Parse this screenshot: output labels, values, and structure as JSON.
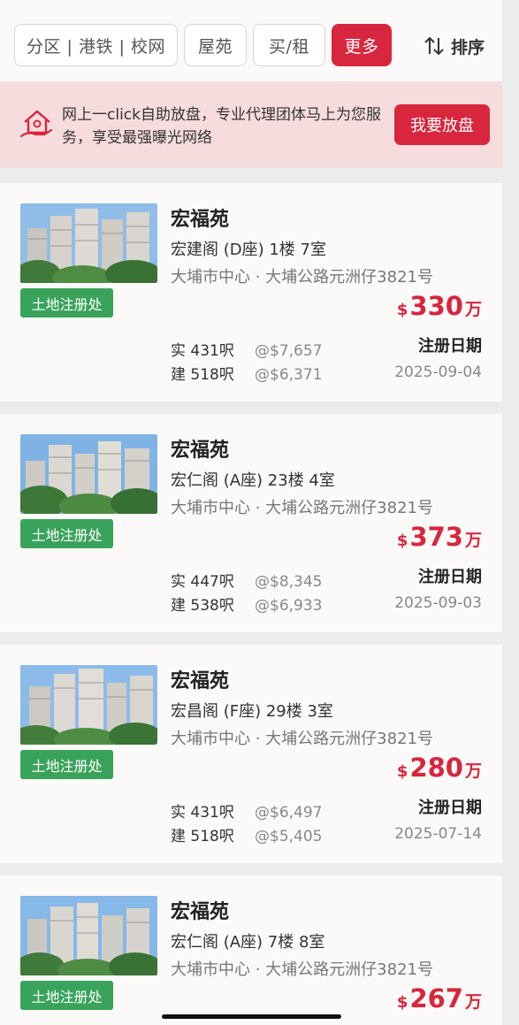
{
  "filters": {
    "district": "分区 | 港铁 | 校网",
    "estate": "屋苑",
    "buy_rent": "买/租",
    "more": "更多",
    "sort": "排序"
  },
  "banner": {
    "text": "网上一click自助放盘，专业代理团体马上为您服务，享受最强曝光网络",
    "cta": "我要放盘"
  },
  "listings": [
    {
      "estate": "宏福苑",
      "unit": "宏建阁 (D座) 1楼 7室",
      "address": "大埔市中心 · 大埔公路元洲仔3821号",
      "tag": "土地注册处",
      "currency": "$",
      "price": "330",
      "price_unit": "万",
      "saleable": "实 431呎",
      "saleable_ppsf": "@$7,657",
      "gross": "建 518呎",
      "gross_ppsf": "@$6,371",
      "reg_label": "注册日期",
      "reg_date": "2025-09-04"
    },
    {
      "estate": "宏福苑",
      "unit": "宏仁阁 (A座) 23楼 4室",
      "address": "大埔市中心 · 大埔公路元洲仔3821号",
      "tag": "土地注册处",
      "currency": "$",
      "price": "373",
      "price_unit": "万",
      "saleable": "实 447呎",
      "saleable_ppsf": "@$8,345",
      "gross": "建 538呎",
      "gross_ppsf": "@$6,933",
      "reg_label": "注册日期",
      "reg_date": "2025-09-03"
    },
    {
      "estate": "宏福苑",
      "unit": "宏昌阁 (F座) 29楼 3室",
      "address": "大埔市中心 · 大埔公路元洲仔3821号",
      "tag": "土地注册处",
      "currency": "$",
      "price": "280",
      "price_unit": "万",
      "saleable": "实 431呎",
      "saleable_ppsf": "@$6,497",
      "gross": "建 518呎",
      "gross_ppsf": "@$5,405",
      "reg_label": "注册日期",
      "reg_date": "2025-07-14"
    },
    {
      "estate": "宏福苑",
      "unit": "宏仁阁 (A座) 7楼 8室",
      "address": "大埔市中心 · 大埔公路元洲仔3821号",
      "tag": "土地注册处",
      "currency": "$",
      "price": "267",
      "price_unit": "万",
      "saleable": "",
      "saleable_ppsf": "",
      "gross": "",
      "gross_ppsf": "",
      "reg_label": "",
      "reg_date": ""
    }
  ],
  "colors": {
    "accent": "#d7263d",
    "tag_green": "#3aa35b",
    "banner_bg": "#f7dcde"
  }
}
